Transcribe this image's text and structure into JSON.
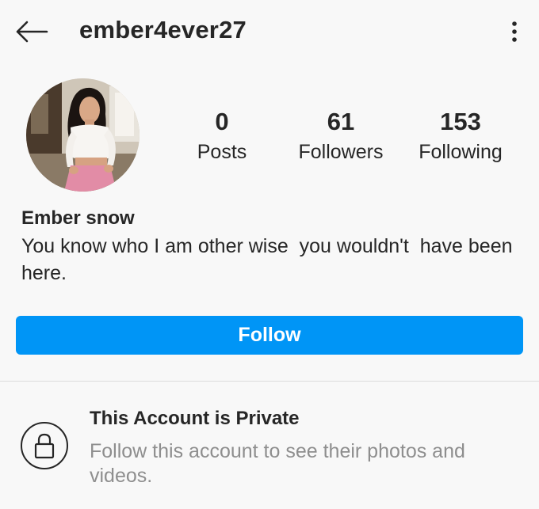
{
  "header": {
    "username": "ember4ever27",
    "back_icon": "arrow-left-icon",
    "more_icon": "more-vertical-icon"
  },
  "profile": {
    "avatar": "profile-photo",
    "stats": {
      "posts": {
        "count": "0",
        "label": "Posts"
      },
      "followers": {
        "count": "61",
        "label": "Followers"
      },
      "following": {
        "count": "153",
        "label": "Following"
      }
    },
    "display_name": "Ember snow",
    "bio": "You know who I am other wise  you wouldn't  have been here."
  },
  "actions": {
    "follow_label": "Follow"
  },
  "private_notice": {
    "icon": "lock-icon",
    "title": "This Account is Private",
    "description": "Follow this account to see their photos and videos."
  },
  "colors": {
    "accent": "#0095f6",
    "text": "#262626",
    "muted": "#8e8e8e",
    "background": "#f8f8f8"
  }
}
